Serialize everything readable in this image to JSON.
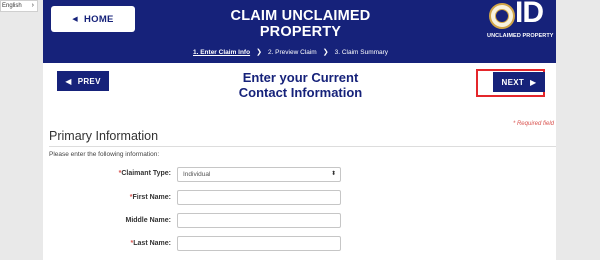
{
  "language": {
    "selected": "English"
  },
  "header": {
    "home_label": "HOME",
    "title": "CLAIM UNCLAIMED PROPERTY",
    "logo_letters": "ID",
    "logo_subtitle": "UNCLAIMED PROPERTY"
  },
  "steps": [
    {
      "label": "1. Enter Claim Info",
      "active": true
    },
    {
      "label": "2. Preview Claim",
      "active": false
    },
    {
      "label": "3. Claim Summary",
      "active": false
    }
  ],
  "nav": {
    "prev_label": "PREV",
    "next_label": "NEXT"
  },
  "page": {
    "heading_line1": "Enter your Current",
    "heading_line2": "Contact Information",
    "required_note": "* Required field"
  },
  "section": {
    "title": "Primary Information",
    "instructions": "Please enter the following information:"
  },
  "form": {
    "claimant_type": {
      "label": "Claimant Type:",
      "required": true,
      "value": "Individual"
    },
    "first_name": {
      "label": "First Name:",
      "required": true,
      "value": ""
    },
    "middle_name": {
      "label": "Middle Name:",
      "required": false,
      "value": ""
    },
    "last_name": {
      "label": "Last Name:",
      "required": true,
      "value": ""
    }
  },
  "colors": {
    "brand_navy": "#16227a",
    "required_red": "#d9534f",
    "highlight_red": "#e4262b"
  }
}
